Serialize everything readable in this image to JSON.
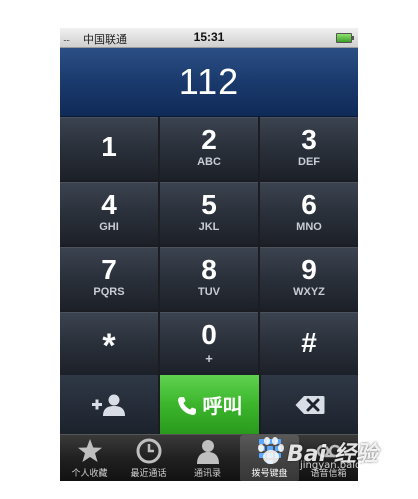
{
  "statusbar": {
    "signal": "....",
    "carrier": "中国联通",
    "time": "15:31"
  },
  "display": {
    "number": "112"
  },
  "keypad": {
    "keys": [
      {
        "digit": "1",
        "letters": ""
      },
      {
        "digit": "2",
        "letters": "ABC"
      },
      {
        "digit": "3",
        "letters": "DEF"
      },
      {
        "digit": "4",
        "letters": "GHI"
      },
      {
        "digit": "5",
        "letters": "JKL"
      },
      {
        "digit": "6",
        "letters": "MNO"
      },
      {
        "digit": "7",
        "letters": "PQRS"
      },
      {
        "digit": "8",
        "letters": "TUV"
      },
      {
        "digit": "9",
        "letters": "WXYZ"
      },
      {
        "digit": "*",
        "letters": ""
      },
      {
        "digit": "0",
        "letters": "+"
      },
      {
        "digit": "#",
        "letters": ""
      }
    ]
  },
  "actions": {
    "add_contact_icon": "add-contact-icon",
    "call_label": "呼叫",
    "call_icon": "phone-handset-icon",
    "delete_icon": "backspace-icon"
  },
  "tabbar": {
    "tabs": [
      {
        "label": "个人收藏",
        "icon": "star-icon",
        "active": false
      },
      {
        "label": "最近通话",
        "icon": "clock-icon",
        "active": false
      },
      {
        "label": "通讯录",
        "icon": "contacts-icon",
        "active": false
      },
      {
        "label": "拨号键盘",
        "icon": "keypad-icon",
        "active": true
      },
      {
        "label": "语音信箱",
        "icon": "voicemail-icon",
        "active": false
      }
    ]
  },
  "watermark": {
    "text": "Bai 经验",
    "sub": "jingyan.baidu.com"
  },
  "colors": {
    "call_green": "#3cb52c",
    "display_blue": "#1a3a6d",
    "key_dark": "#2a303a"
  }
}
